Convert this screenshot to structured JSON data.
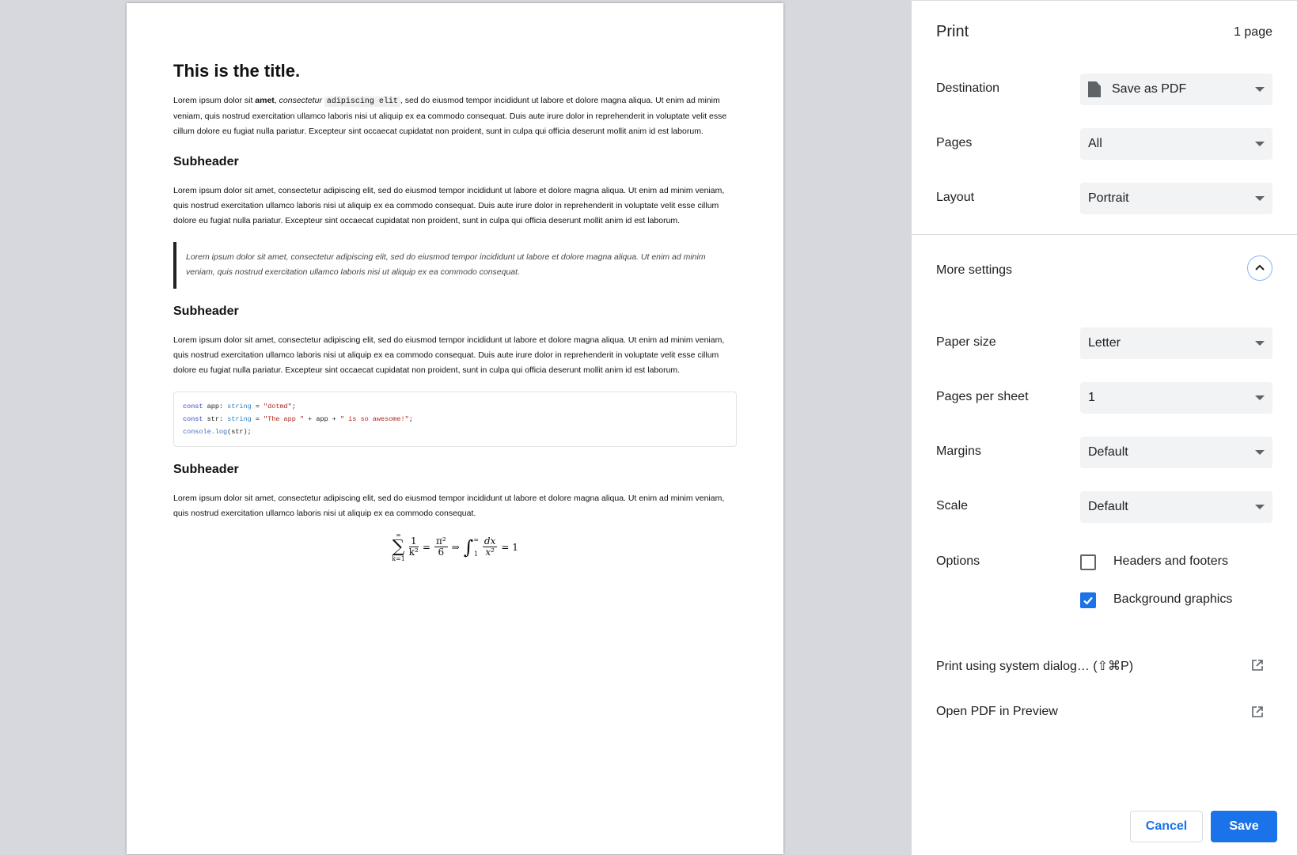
{
  "document": {
    "title": "This is the title.",
    "para1": {
      "t1": "Lorem ipsum dolor sit ",
      "bold": "amet",
      "t2": ", ",
      "italic": "consectetur",
      "t3": " ",
      "code": "adipiscing elit",
      "t4": ", sed do eiusmod tempor incididunt ut labore et dolore magna aliqua. Ut enim ad minim veniam, quis nostrud exercitation ullamco laboris nisi ut aliquip ex ea commodo consequat. Duis aute irure dolor in reprehenderit in voluptate velit esse cillum dolore eu fugiat nulla pariatur. Excepteur sint occaecat cupidatat non proident, sunt in culpa qui officia deserunt mollit anim id est laborum."
    },
    "subheader1": "Subheader",
    "para2": "Lorem ipsum dolor sit amet, consectetur adipiscing elit, sed do eiusmod tempor incididunt ut labore et dolore magna aliqua. Ut enim ad minim veniam, quis nostrud exercitation ullamco laboris nisi ut aliquip ex ea commodo consequat. Duis aute irure dolor in reprehenderit in voluptate velit esse cillum dolore eu fugiat nulla pariatur. Excepteur sint occaecat cupidatat non proident, sunt in culpa qui officia deserunt mollit anim id est laborum.",
    "quote": "Lorem ipsum dolor sit amet, consectetur adipiscing elit, sed do eiusmod tempor incididunt ut labore et dolore magna aliqua. Ut enim ad minim veniam, quis nostrud exercitation ullamco laboris nisi ut aliquip ex ea commodo consequat.",
    "subheader2": "Subheader",
    "para3": "Lorem ipsum dolor sit amet, consectetur adipiscing elit, sed do eiusmod tempor incididunt ut labore et dolore magna aliqua. Ut enim ad minim veniam, quis nostrud exercitation ullamco laboris nisi ut aliquip ex ea commodo consequat. Duis aute irure dolor in reprehenderit in voluptate velit esse cillum dolore eu fugiat nulla pariatur. Excepteur sint occaecat cupidatat non proident, sunt in culpa qui officia deserunt mollit anim id est laborum.",
    "code": {
      "l1_kw": "const",
      "l1_a": " app: ",
      "l1_ty": "string",
      "l1_b": " = ",
      "l1_str": "\"dotmd\"",
      "l1_c": ";",
      "l2_kw": "const",
      "l2_a": " str: ",
      "l2_ty": "string",
      "l2_b": " = ",
      "l2_str1": "\"The app \"",
      "l2_c": " + app + ",
      "l2_str2": "\" is so awesome!\"",
      "l2_d": ";",
      "l3_fn": "console.log",
      "l3_a": "(str);"
    },
    "subheader3": "Subheader",
    "para4": "Lorem ipsum dolor sit amet, consectetur adipiscing elit, sed do eiusmod tempor incididunt ut labore et dolore magna aliqua. Ut enim ad minim veniam, quis nostrud exercitation ullamco laboris nisi ut aliquip ex ea commodo consequat.",
    "math": {
      "sum": "∑",
      "sum_top": "∞",
      "sum_bot": "k=1",
      "f1_num": "1",
      "f1_den": "k²",
      "eq1": "=",
      "f2_num": "π²",
      "f2_den": "6",
      "implies": "⇒",
      "int": "∫",
      "int_top": "∞",
      "int_bot": "1",
      "f3_num": "dx",
      "f3_den": "x²",
      "eq2": "= 1"
    }
  },
  "panel": {
    "title": "Print",
    "page_count": "1 page",
    "destination": {
      "label": "Destination",
      "value": "Save as PDF",
      "icon": "file-icon"
    },
    "pages": {
      "label": "Pages",
      "value": "All"
    },
    "layout": {
      "label": "Layout",
      "value": "Portrait"
    },
    "more_settings": {
      "label": "More settings",
      "icon": "chevron-up-icon"
    },
    "paper_size": {
      "label": "Paper size",
      "value": "Letter"
    },
    "pages_per_sheet": {
      "label": "Pages per sheet",
      "value": "1"
    },
    "margins": {
      "label": "Margins",
      "value": "Default"
    },
    "scale": {
      "label": "Scale",
      "value": "Default"
    },
    "options": {
      "label": "Options",
      "headers_footers": {
        "label": "Headers and footers",
        "checked": false
      },
      "background_graphics": {
        "label": "Background graphics",
        "checked": true
      }
    },
    "system_dialog": "Print using system dialog… (⇧⌘P)",
    "open_pdf": "Open PDF in Preview",
    "cancel": "Cancel",
    "save": "Save"
  },
  "colors": {
    "accent": "#1a73e8",
    "preview_bg": "#d6d8dd",
    "select_bg": "#f1f3f4"
  }
}
